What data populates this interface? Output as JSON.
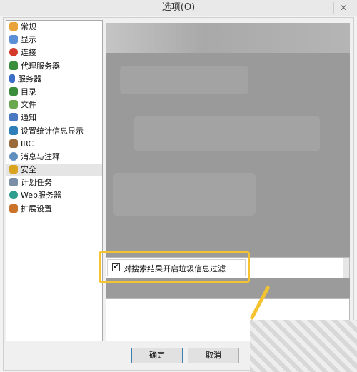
{
  "window": {
    "title": "选项(O)",
    "close_glyph": "✕"
  },
  "nav": {
    "items": [
      {
        "label": "常规",
        "icon": "settings-icon",
        "color": "#e8a33a"
      },
      {
        "label": "显示",
        "icon": "display-icon",
        "color": "#5b8fd6"
      },
      {
        "label": "连接",
        "icon": "apple-icon",
        "color": "#d33a2c"
      },
      {
        "label": "代理服务器",
        "icon": "proxy-icon",
        "color": "#3a8d3a"
      },
      {
        "label": "服务器",
        "icon": "server-icon",
        "color": "#3b6fc7"
      },
      {
        "label": "目录",
        "icon": "folder-icon",
        "color": "#3a8d3a"
      },
      {
        "label": "文件",
        "icon": "files-icon",
        "color": "#6aa84f"
      },
      {
        "label": "通知",
        "icon": "notification-icon",
        "color": "#4a78c2"
      },
      {
        "label": "设置统计信息显示",
        "icon": "stats-icon",
        "color": "#2e7fb8"
      },
      {
        "label": "IRC",
        "icon": "irc-icon",
        "color": "#9a6a3a"
      },
      {
        "label": "消息与注释",
        "icon": "message-icon",
        "color": "#5f8fbf"
      },
      {
        "label": "安全",
        "icon": "lock-icon",
        "color": "#d9a520"
      },
      {
        "label": "计划任务",
        "icon": "schedule-icon",
        "color": "#7a8fa6"
      },
      {
        "label": "Web服务器",
        "icon": "web-icon",
        "color": "#2f9e8f"
      },
      {
        "label": "扩展设置",
        "icon": "extension-icon",
        "color": "#c9742a"
      }
    ],
    "selected": "安全"
  },
  "option": {
    "label": "对搜索结果开启垃圾信息过滤",
    "checked": true,
    "check_glyph": "✔"
  },
  "buttons": {
    "ok": "确定",
    "cancel": "取消"
  },
  "colors": {
    "highlight": "#f5c330",
    "selected_bg": "#e5e5e5"
  }
}
